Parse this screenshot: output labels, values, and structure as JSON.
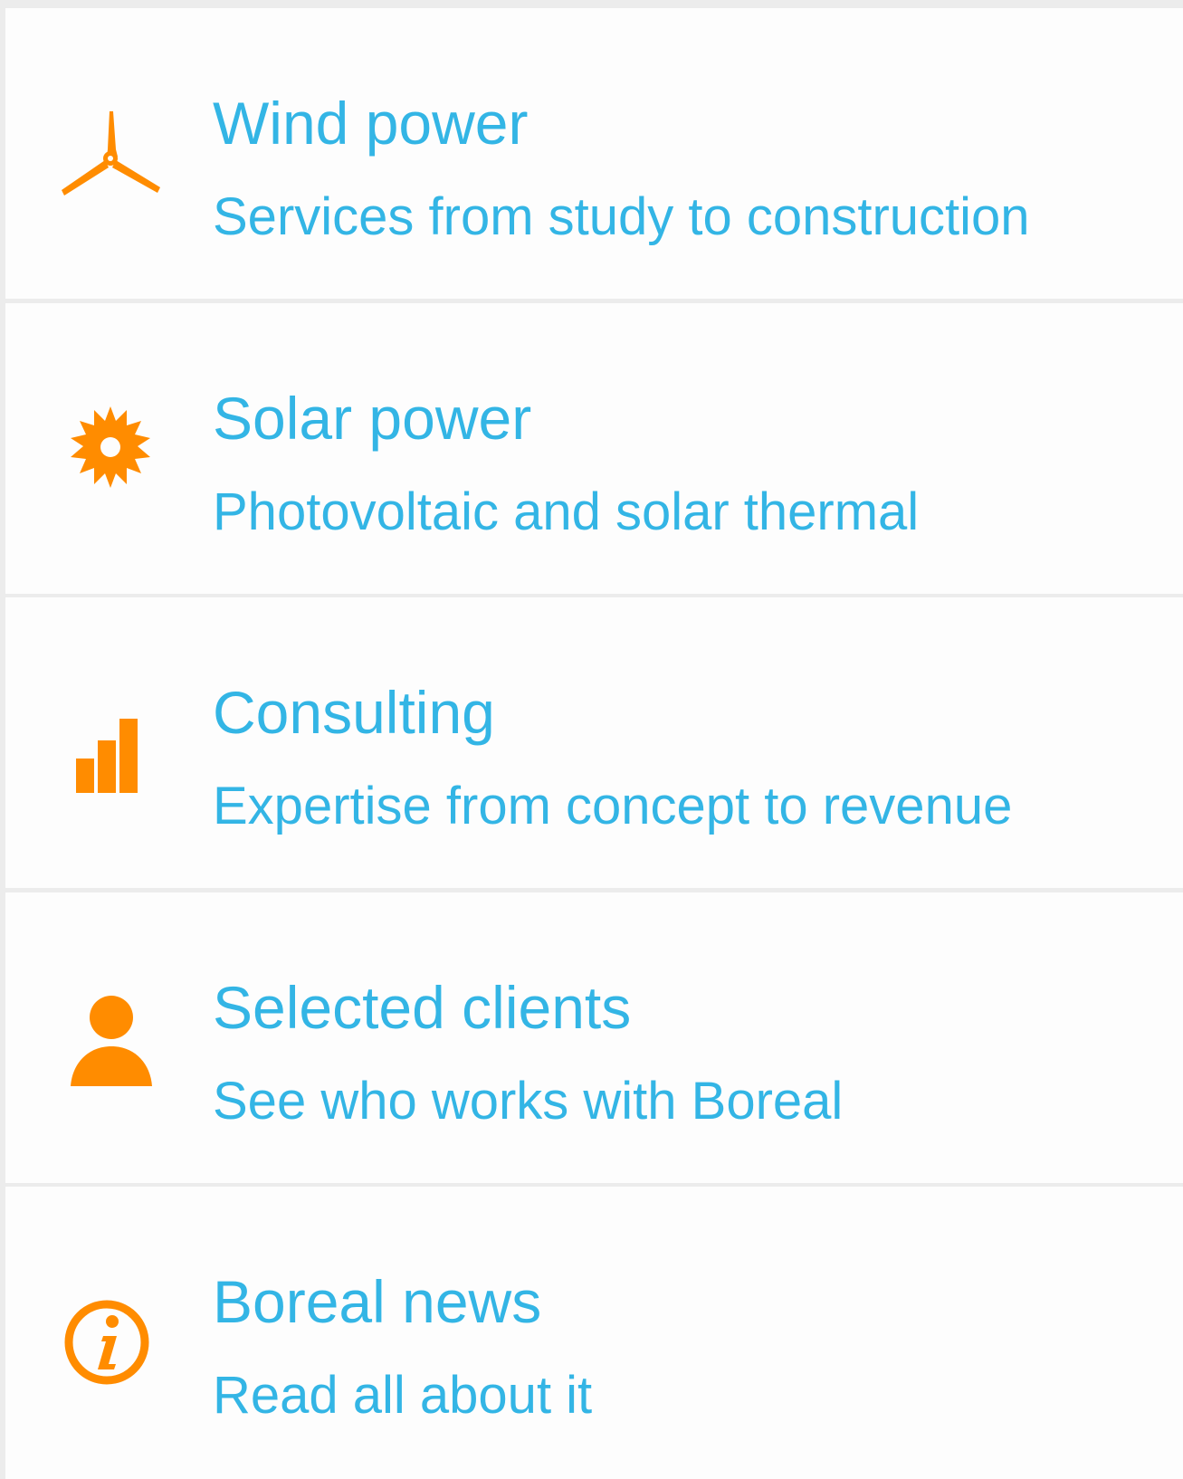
{
  "colors": {
    "accent_text": "#33b5e5",
    "icon": "#ff8c00",
    "item_background": "#fdfdfd",
    "divider": "#ececec"
  },
  "menu": {
    "items": [
      {
        "title": "Wind power",
        "subtitle": "Services from study to construction",
        "icon": "wind-turbine-icon"
      },
      {
        "title": "Solar power",
        "subtitle": "Photovoltaic and solar thermal",
        "icon": "sun-icon"
      },
      {
        "title": "Consulting",
        "subtitle": "Expertise from concept to revenue",
        "icon": "bar-chart-icon"
      },
      {
        "title": "Selected clients",
        "subtitle": "See who works with Boreal",
        "icon": "person-icon"
      },
      {
        "title": "Boreal news",
        "subtitle": "Read all about it",
        "icon": "info-icon"
      }
    ]
  }
}
